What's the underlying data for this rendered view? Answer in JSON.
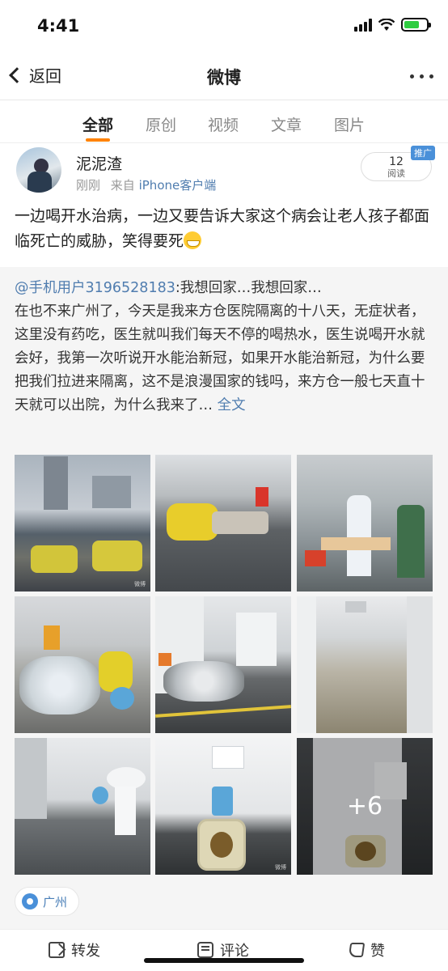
{
  "status_bar": {
    "time": "4:41"
  },
  "nav": {
    "back_label": "返回",
    "title": "微博"
  },
  "tabs": [
    {
      "label": "全部",
      "active": true
    },
    {
      "label": "原创",
      "active": false
    },
    {
      "label": "视频",
      "active": false
    },
    {
      "label": "文章",
      "active": false
    },
    {
      "label": "图片",
      "active": false
    }
  ],
  "post": {
    "username": "泥泥渣",
    "time": "刚刚",
    "source_prefix": "来自",
    "source_client": "iPhone客户端",
    "read_count": "12",
    "read_label": "阅读",
    "promo_tag": "推广",
    "text": "一边喝开水治病，一边又要告诉大家这个病会让老人孩子都面临死亡的威胁，笑得要死"
  },
  "repost": {
    "mention": "@手机用户3196528183",
    "text_first": ":我想回家…我想回家…",
    "text_body": "在也不来广州了，今天是我来方仓医院隔离的十八天，无症状者，这里没有药吃，医生就叫我们每天不停的喝热水，医生说喝开水就会好，我第一次听说开水能治新冠，如果开水能治新冠，为什么要把我们拉进来隔离，这不是浪漫国家的钱吗，来方仓一般七天直十天就可以出院，为什么我来了…",
    "full_text_link": "全文",
    "extra_images": "+6",
    "location": "广州"
  },
  "actions": {
    "forward": "转发",
    "comment": "评论",
    "like": "赞"
  },
  "colors": {
    "accent": "#ff8200",
    "link": "#507daf",
    "location": "#4a90d9"
  }
}
